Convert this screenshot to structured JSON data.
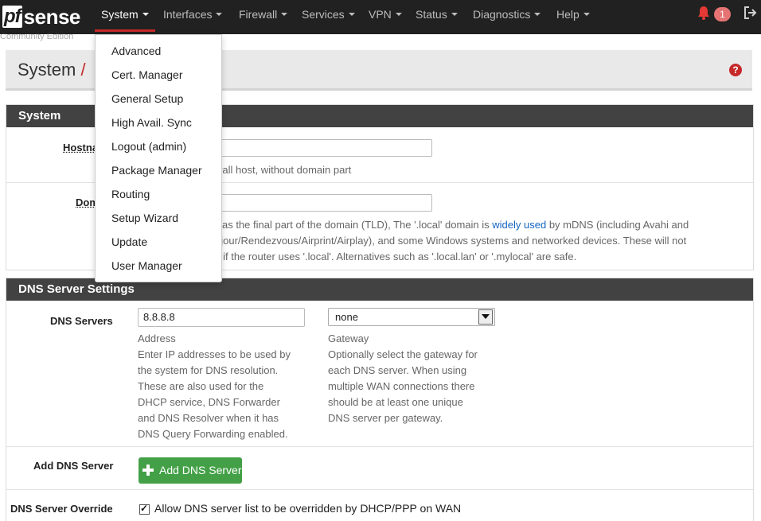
{
  "nav": {
    "logo_pf": "pf",
    "logo_sense": "sense",
    "items": [
      "System",
      "Interfaces",
      "Firewall",
      "Services",
      "VPN",
      "Status",
      "Diagnostics",
      "Help"
    ],
    "notification_count": "1",
    "bell_icon": "bell-icon",
    "logout_icon": "logout-icon"
  },
  "background_text": "Community Edition",
  "breadcrumb": {
    "part1": "System",
    "separator": "/"
  },
  "dropdown": {
    "items": [
      "Advanced",
      "Cert. Manager",
      "General Setup",
      "High Avail. Sync",
      "Logout (admin)",
      "Package Manager",
      "Routing",
      "Setup Wizard",
      "Update",
      "User Manager"
    ]
  },
  "system_panel": {
    "heading": "System",
    "hostname_label": "Hostna",
    "hostname_help": "wall host, without domain part",
    "domain_label": "Dom",
    "domain_help_line1_a": "l' as the final part of the domain (TLD), The '.local' domain is ",
    "domain_help_link": "widely used",
    "domain_help_line1_b": " by mDNS (including Avahi and",
    "domain_help_line2": "ajour/Rendezvous/Airprint/Airplay), and some Windows systems and networked devices. These will not",
    "domain_help_line3": "y if the router uses '.local'. Alternatives such as '.local.lan' or '.mylocal' are safe."
  },
  "dns_panel": {
    "heading": "DNS Server Settings",
    "dns_label": "DNS Servers",
    "dns_value": "8.8.8.8",
    "address_label": "Address",
    "address_help": [
      "Enter IP addresses to be used by",
      "the system for DNS resolution.",
      "These are also used for the",
      "DHCP service, DNS Forwarder",
      "and DNS Resolver when it has",
      "DNS Query Forwarding enabled."
    ],
    "gateway_value": "none",
    "gateway_label": "Gateway",
    "gateway_help": [
      "Optionally select the gateway for",
      "each DNS server. When using",
      "multiple WAN connections there",
      "should be at least one unique",
      "DNS server per gateway."
    ],
    "add_label": "Add DNS Server",
    "add_button": "Add DNS Server",
    "override_label": "DNS Server Override",
    "override_text": "Allow DNS server list to be overridden by DHCP/PPP on WAN"
  },
  "colors": {
    "navbar": "#212121",
    "accent_red": "#c62828",
    "success": "#43a047",
    "panel_heading": "#424242",
    "link": "#1565c0"
  }
}
